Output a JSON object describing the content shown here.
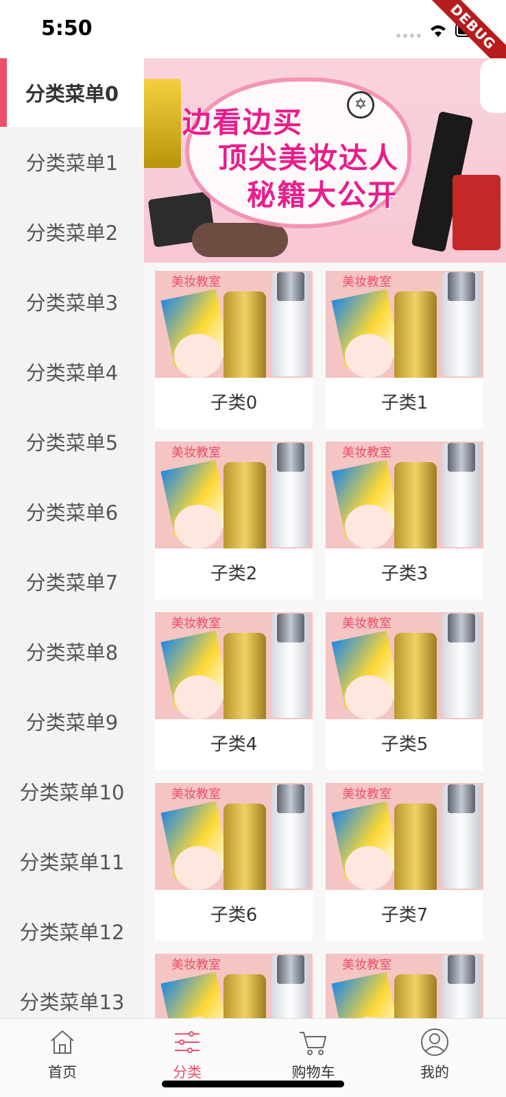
{
  "status_bar": {
    "time": "5:50",
    "debug": "DEBUG"
  },
  "categories": [
    "分类菜单0",
    "分类菜单1",
    "分类菜单2",
    "分类菜单3",
    "分类菜单4",
    "分类菜单5",
    "分类菜单6",
    "分类菜单7",
    "分类菜单8",
    "分类菜单9",
    "分类菜单10",
    "分类菜单11",
    "分类菜单12",
    "分类菜单13"
  ],
  "active_category_index": 0,
  "banner": {
    "line1": "边看边买",
    "line2": "顶尖美妆达人",
    "line3": "秘籍大公开"
  },
  "subcategories": [
    {
      "label": "子类0",
      "tag": "美妆教室"
    },
    {
      "label": "子类1",
      "tag": "美妆教室"
    },
    {
      "label": "子类2",
      "tag": "美妆教室"
    },
    {
      "label": "子类3",
      "tag": "美妆教室"
    },
    {
      "label": "子类4",
      "tag": "美妆教室"
    },
    {
      "label": "子类5",
      "tag": "美妆教室"
    },
    {
      "label": "子类6",
      "tag": "美妆教室"
    },
    {
      "label": "子类7",
      "tag": "美妆教室"
    },
    {
      "label": "",
      "tag": "美妆教室"
    },
    {
      "label": "",
      "tag": "美妆教室"
    }
  ],
  "tabs": [
    {
      "label": "首页",
      "icon": "home-icon"
    },
    {
      "label": "分类",
      "icon": "category-icon"
    },
    {
      "label": "购物车",
      "icon": "cart-icon"
    },
    {
      "label": "我的",
      "icon": "profile-icon"
    }
  ],
  "active_tab_index": 1,
  "colors": {
    "accent": "#ec4f6a",
    "menu_bg": "#f3f3f3"
  }
}
